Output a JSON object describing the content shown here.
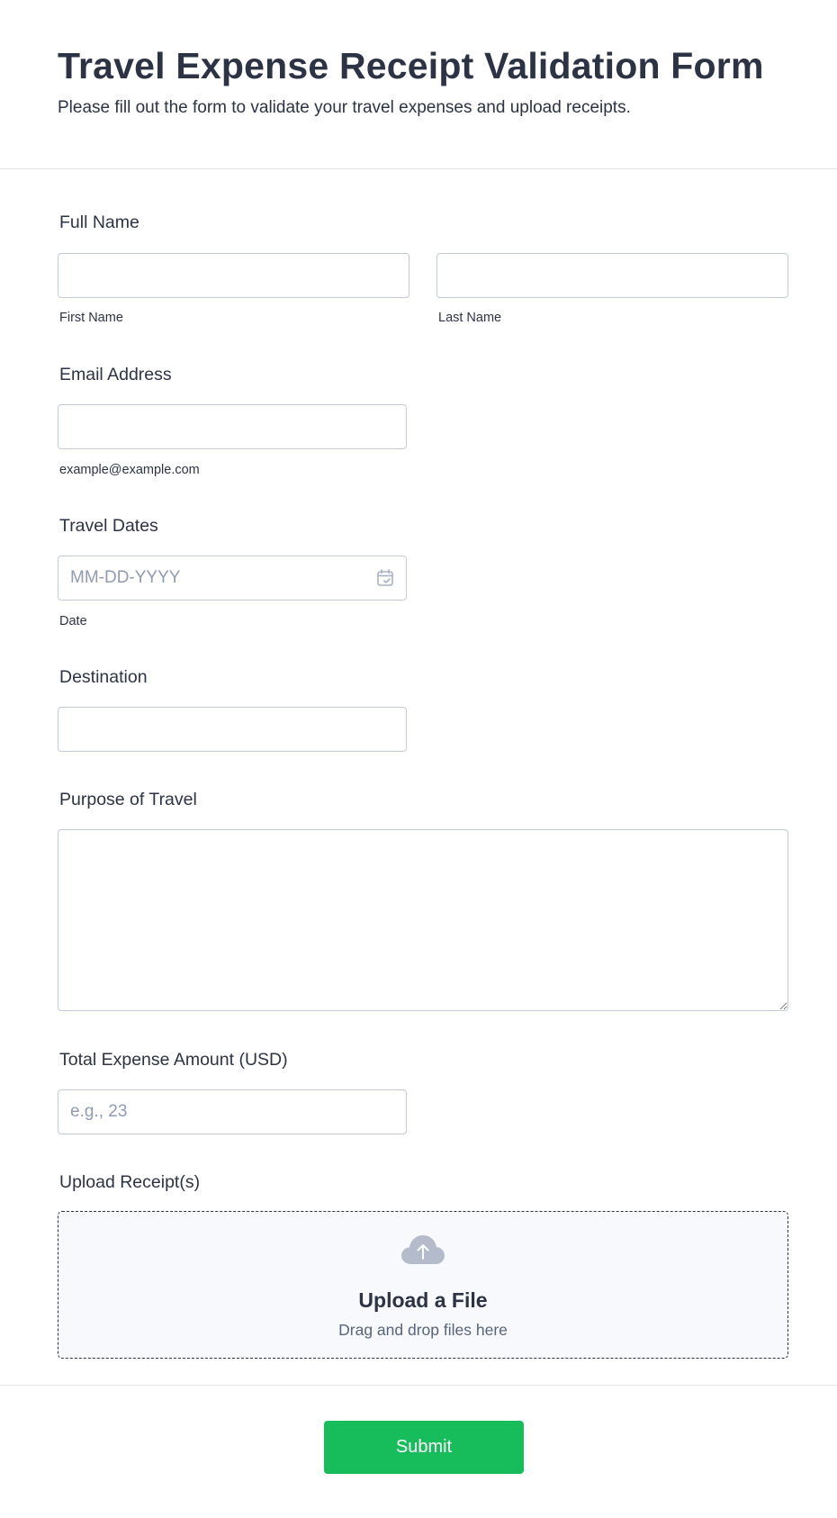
{
  "header": {
    "title": "Travel Expense Receipt Validation Form",
    "subtitle": "Please fill out the form to validate your travel expenses and upload receipts."
  },
  "fields": {
    "full_name": {
      "label": "Full Name",
      "first_value": "",
      "first_sublabel": "First Name",
      "last_value": "",
      "last_sublabel": "Last Name"
    },
    "email": {
      "label": "Email Address",
      "value": "",
      "sublabel": "example@example.com"
    },
    "travel_dates": {
      "label": "Travel Dates",
      "placeholder": "MM-DD-YYYY",
      "sublabel": "Date",
      "icon": "calendar-icon"
    },
    "destination": {
      "label": "Destination",
      "value": ""
    },
    "purpose": {
      "label": "Purpose of Travel",
      "value": ""
    },
    "total_amount": {
      "label": "Total Expense Amount (USD)",
      "placeholder": "e.g., 23"
    },
    "upload": {
      "label": "Upload Receipt(s)",
      "title": "Upload a File",
      "hint": "Drag and drop files here",
      "icon": "cloud-upload-icon"
    }
  },
  "footer": {
    "submit_label": "Submit"
  },
  "colors": {
    "accent": "#18bd5b",
    "text": "#2c3345",
    "border": "#c3cad8",
    "placeholder": "#8f9bb3",
    "upload_bg": "#f8f9fc"
  }
}
